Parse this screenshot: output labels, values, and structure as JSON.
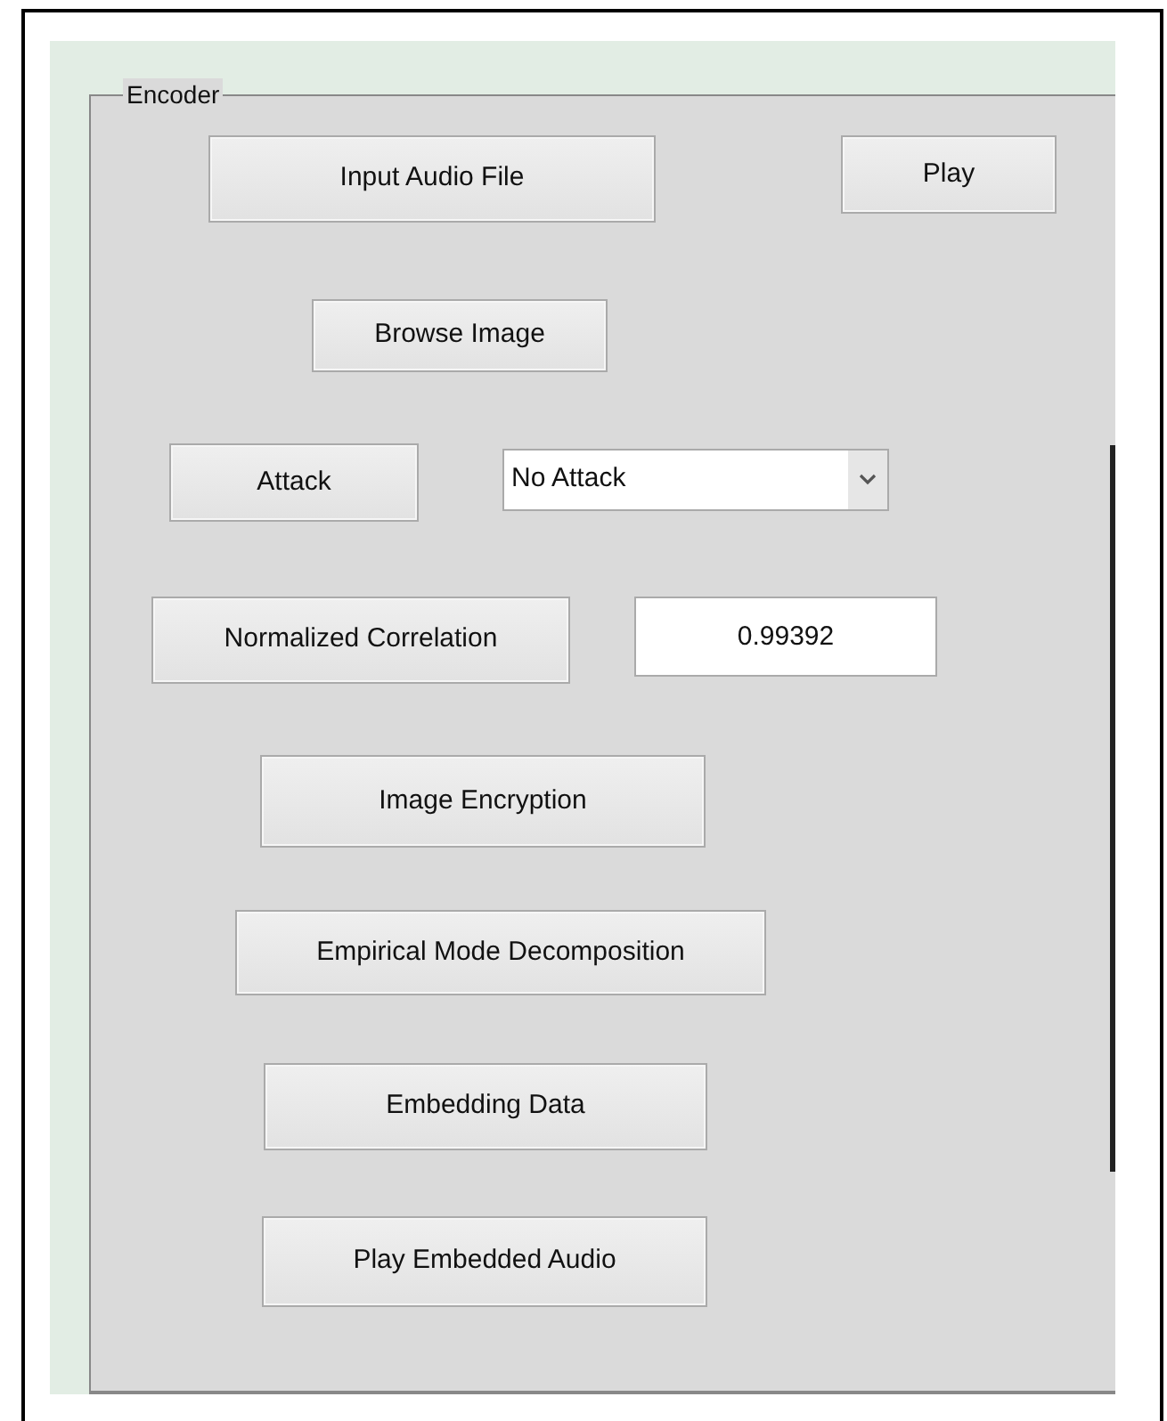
{
  "panel": {
    "title": "Encoder"
  },
  "controls": [
    {
      "kind": "button",
      "label": "Input Audio File"
    },
    {
      "kind": "button",
      "label": "Play"
    },
    {
      "kind": "button",
      "label": "Browse Image"
    },
    {
      "kind": "button",
      "label": "Attack"
    },
    {
      "kind": "dropdown",
      "value": "No Attack"
    },
    {
      "kind": "button",
      "label": "Normalized Correlation"
    },
    {
      "kind": "field",
      "value": "0.99392"
    },
    {
      "kind": "button",
      "label": "Image Encryption"
    },
    {
      "kind": "button",
      "label": "Empirical Mode Decomposition"
    },
    {
      "kind": "button",
      "label": "Embedding Data"
    },
    {
      "kind": "button",
      "label": "Play Embedded Audio"
    }
  ]
}
